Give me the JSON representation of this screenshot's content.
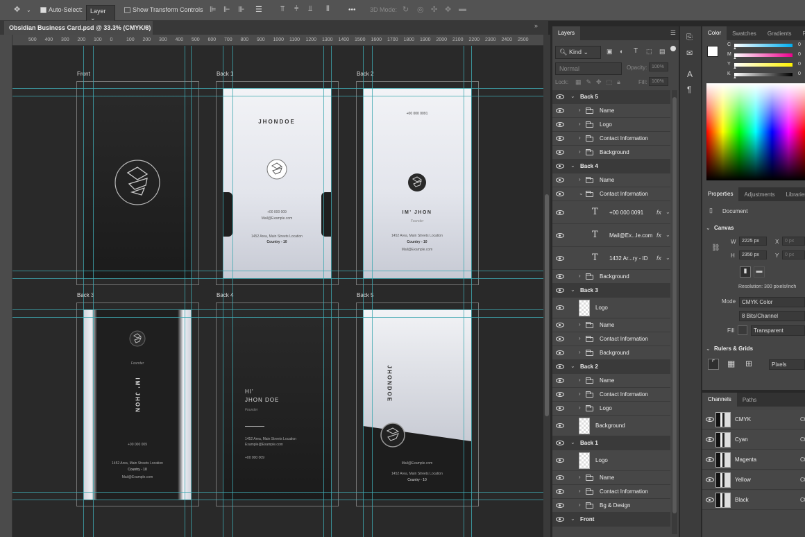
{
  "options_bar": {
    "auto_select_label": "Auto-Select:",
    "auto_select_target": "Layer",
    "show_transform_label": "Show Transform Controls",
    "more": "•••",
    "mode_3d": "3D Mode:"
  },
  "document_tab": {
    "title": "Obsidian Business Card.psd @ 33.3% (CMYK/8)",
    "close": "×"
  },
  "ruler_numbers": [
    "500",
    "400",
    "300",
    "200",
    "100",
    "0",
    "100",
    "200",
    "300",
    "400",
    "500",
    "600",
    "700",
    "800",
    "900",
    "1000",
    "1100",
    "1200",
    "1300",
    "1400",
    "1500",
    "1600",
    "1700",
    "1800",
    "1900",
    "2000",
    "2100",
    "2200",
    "2300",
    "2400",
    "2500"
  ],
  "artboards": {
    "front_label": "Front",
    "back1_label": "Back 1",
    "back2_label": "Back 2",
    "back3_label": "Back 3",
    "back4_label": "Back 4",
    "back5_label": "Back 5"
  },
  "card_back1": {
    "name": "JHONDOE",
    "phone": "+00 000 009",
    "email": "Mail@Example.com",
    "address": "1452 Area, Main Streets Location",
    "country": "Country - 10"
  },
  "card_back2": {
    "phone": "+00 000 0091",
    "name": "IM' JHON",
    "role": "Founder",
    "address": "1452 Area, Main Streets Location",
    "country": "Country - 10",
    "email": "Mail@Example.com"
  },
  "card_back3": {
    "role": "Founder",
    "name": "IM' JHON",
    "phone": "+00 000 009",
    "address": "1452 Area, Main Streets Location",
    "country": "Country - 10",
    "email": "Mail@Example.com"
  },
  "card_back4": {
    "greeting": "HI'",
    "name": "JHON DOE",
    "role": "Founder",
    "address": "1452 Area, Main Streets Location",
    "email": "Example@Example.com",
    "phone": "+00 000 009"
  },
  "card_back5": {
    "name": "JHONDOE",
    "email": "Mail@Example.com",
    "address": "1452 Area, Main Streets Location",
    "country": "Country - 10"
  },
  "layers_panel": {
    "tab": "Layers",
    "kind_filter": "Kind",
    "blend_mode": "Normal",
    "opacity_label": "Opacity:",
    "opacity_value": "100%",
    "lock_label": "Lock:",
    "fill_label": "Fill:",
    "fill_value": "100%",
    "layers": [
      {
        "label": "Back 5",
        "kind": "group"
      },
      {
        "label": "Name",
        "kind": "folder"
      },
      {
        "label": "Logo",
        "kind": "folder"
      },
      {
        "label": "Contact Information",
        "kind": "folder"
      },
      {
        "label": "Background",
        "kind": "folder"
      },
      {
        "label": "Back 4",
        "kind": "group"
      },
      {
        "label": "Name",
        "kind": "folder"
      },
      {
        "label": "Contact Information",
        "kind": "folder-open"
      },
      {
        "label": "+00 000 0091",
        "kind": "text"
      },
      {
        "label": "Mail@Ex...le.com",
        "kind": "text"
      },
      {
        "label": "1432 Ar...ry - ID",
        "kind": "text"
      },
      {
        "label": "Background",
        "kind": "folder"
      },
      {
        "label": "Back 3",
        "kind": "group"
      },
      {
        "label": "Logo",
        "kind": "smart"
      },
      {
        "label": "Name",
        "kind": "folder"
      },
      {
        "label": "Contact Information",
        "kind": "folder"
      },
      {
        "label": "Background",
        "kind": "folder"
      },
      {
        "label": "Back 2",
        "kind": "group"
      },
      {
        "label": "Name",
        "kind": "folder"
      },
      {
        "label": "Contact Information",
        "kind": "folder"
      },
      {
        "label": "Logo",
        "kind": "folder"
      },
      {
        "label": "Background",
        "kind": "smart"
      },
      {
        "label": "Back 1",
        "kind": "group"
      },
      {
        "label": "Logo",
        "kind": "smart"
      },
      {
        "label": "Name",
        "kind": "folder"
      },
      {
        "label": "Contact Information",
        "kind": "folder"
      },
      {
        "label": "Bg & Design",
        "kind": "folder"
      },
      {
        "label": "Front",
        "kind": "group"
      }
    ],
    "fx_label": "fx"
  },
  "color_panel": {
    "tabs": [
      "Color",
      "Swatches",
      "Gradients",
      "Patte"
    ],
    "channels": [
      {
        "key": "C",
        "value": "0"
      },
      {
        "key": "M",
        "value": "0"
      },
      {
        "key": "Y",
        "value": "0"
      },
      {
        "key": "K",
        "value": "0"
      }
    ]
  },
  "properties_panel": {
    "tabs": [
      "Properties",
      "Adjustments",
      "Libraries"
    ],
    "document_label": "Document",
    "canvas_label": "Canvas",
    "w_label": "W",
    "w_value": "2225 px",
    "x_label": "X",
    "x_value": "0 px",
    "h_label": "H",
    "h_value": "2350 px",
    "y_label": "Y",
    "y_value": "0 px",
    "resolution": "Resolution: 300 pixels/inch",
    "mode_label": "Mode",
    "mode_value": "CMYK Color",
    "bits_value": "8 Bits/Channel",
    "fill_label": "Fill",
    "fill_value": "Transparent",
    "rulers_label": "Rulers & Grids",
    "units_value": "Pixels"
  },
  "channels_panel": {
    "tabs": [
      "Channels",
      "Paths"
    ],
    "channels": [
      {
        "name": "CMYK",
        "shortcut": "Ct"
      },
      {
        "name": "Cyan",
        "shortcut": "Ct"
      },
      {
        "name": "Magenta",
        "shortcut": "Ct"
      },
      {
        "name": "Yellow",
        "shortcut": "Ct"
      },
      {
        "name": "Black",
        "shortcut": "Ct"
      }
    ]
  }
}
